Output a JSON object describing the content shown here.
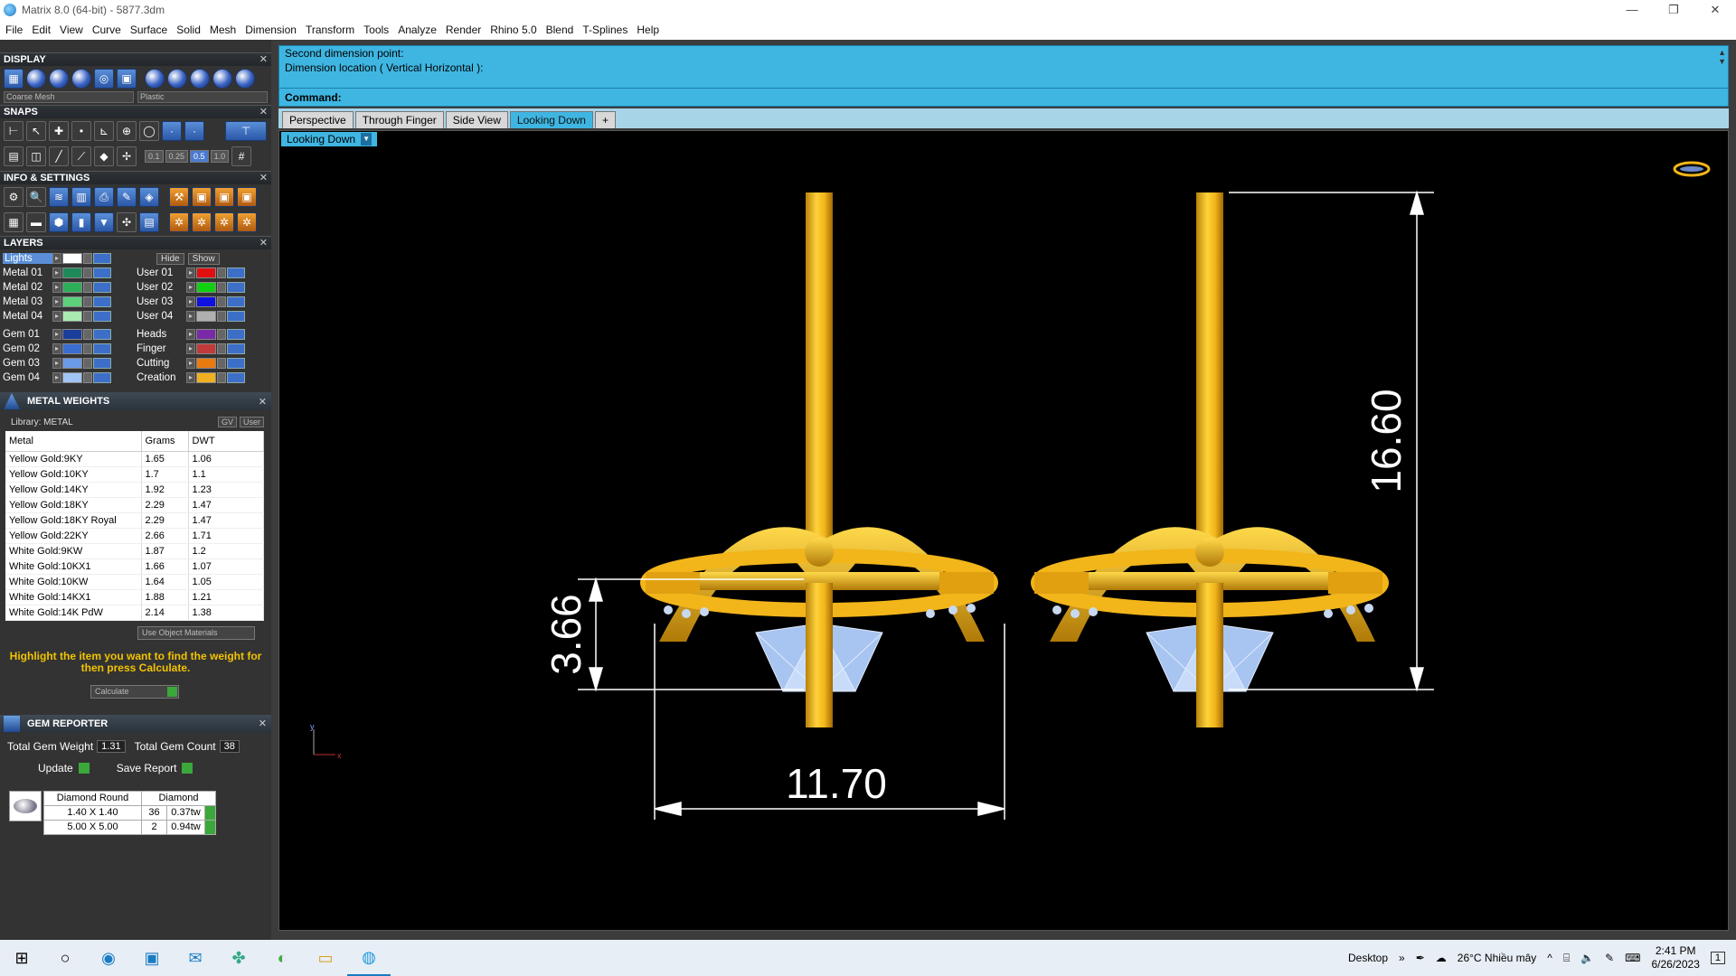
{
  "app": {
    "title": "Matrix 8.0 (64-bit) - 5877.3dm",
    "window_buttons": [
      "—",
      "❐",
      "✕"
    ]
  },
  "menu": [
    "File",
    "Edit",
    "View",
    "Curve",
    "Surface",
    "Solid",
    "Mesh",
    "Dimension",
    "Transform",
    "Tools",
    "Analyze",
    "Render",
    "Rhino 5.0",
    "Blend",
    "T-Splines",
    "Help"
  ],
  "panels": {
    "display": {
      "title": "DISPLAY",
      "mode": "Coarse Mesh",
      "material": "Plastic"
    },
    "snaps": {
      "title": "SNAPS",
      "values": [
        "0.1",
        "0.25",
        "0.5",
        "1.0"
      ]
    },
    "info": {
      "title": "INFO & SETTINGS"
    },
    "layers": {
      "title": "LAYERS",
      "hide": "Hide",
      "show": "Show",
      "lights": "Lights",
      "rows": [
        [
          {
            "name": "Metal 01",
            "color": "#1e8a5a"
          },
          {
            "name": "User 01",
            "color": "#e01010"
          }
        ],
        [
          {
            "name": "Metal 02",
            "color": "#2fae5a"
          },
          {
            "name": "User 02",
            "color": "#10d010"
          }
        ],
        [
          {
            "name": "Metal 03",
            "color": "#5cd07a"
          },
          {
            "name": "User 03",
            "color": "#1010e0"
          }
        ],
        [
          {
            "name": "Metal 04",
            "color": "#a8eab0"
          },
          {
            "name": "User 04",
            "color": "#b0b0b0"
          }
        ],
        [
          {
            "name": "Gem 01",
            "color": "#1a3e9a"
          },
          {
            "name": "Heads",
            "color": "#7a2aa8"
          }
        ],
        [
          {
            "name": "Gem 02",
            "color": "#3a6ed0"
          },
          {
            "name": "Finger",
            "color": "#c03a3a"
          }
        ],
        [
          {
            "name": "Gem 03",
            "color": "#6a9ae8"
          },
          {
            "name": "Cutting",
            "color": "#e87a10"
          }
        ],
        [
          {
            "name": "Gem 04",
            "color": "#a0c4f4"
          },
          {
            "name": "Creation",
            "color": "#f0b020"
          }
        ]
      ]
    },
    "metal_weights": {
      "title": "METAL WEIGHTS",
      "library": "Library: METAL",
      "gv": "GV",
      "user": "User",
      "headers": [
        "Metal",
        "Grams",
        "DWT"
      ],
      "rows": [
        [
          "Yellow Gold:9KY",
          "1.65",
          "1.06"
        ],
        [
          "Yellow Gold:10KY",
          "1.7",
          "1.1"
        ],
        [
          "Yellow Gold:14KY",
          "1.92",
          "1.23"
        ],
        [
          "Yellow Gold:18KY",
          "2.29",
          "1.47"
        ],
        [
          "Yellow Gold:18KY Royal",
          "2.29",
          "1.47"
        ],
        [
          "Yellow Gold:22KY",
          "2.66",
          "1.71"
        ],
        [
          "White Gold:9KW",
          "1.87",
          "1.2"
        ],
        [
          "White Gold:10KX1",
          "1.66",
          "1.07"
        ],
        [
          "White Gold:10KW",
          "1.64",
          "1.05"
        ],
        [
          "White Gold:14KX1",
          "1.88",
          "1.21"
        ],
        [
          "White Gold:14K PdW",
          "2.14",
          "1.38"
        ]
      ],
      "use_object": "Use Object Materials",
      "hint": "Highlight the item you want to find the weight for then press Calculate.",
      "calculate": "Calculate"
    },
    "gem_reporter": {
      "title": "GEM REPORTER",
      "total_weight_label": "Total Gem Weight",
      "total_weight": "1.31",
      "total_count_label": "Total Gem Count",
      "total_count": "38",
      "update": "Update",
      "save": "Save Report",
      "headers": [
        "Diamond Round",
        "Diamond"
      ],
      "rows": [
        [
          "1.40 X 1.40",
          "36",
          "0.37tw"
        ],
        [
          "5.00 X 5.00",
          "2",
          "0.94tw"
        ]
      ]
    }
  },
  "command": {
    "line1": "Second dimension point:",
    "line2": "Dimension location ( Vertical  Horizontal ):",
    "prompt": "Command:"
  },
  "tabs": [
    "Perspective",
    "Through Finger",
    "Side View",
    "Looking Down",
    "+"
  ],
  "active_tab": "Looking Down",
  "viewport": {
    "label": "Looking Down",
    "dimensions": {
      "width": "11.70",
      "height": "16.60",
      "depth": "3.66"
    },
    "axes": {
      "y": "y",
      "x": "x"
    }
  },
  "colors": {
    "accent": "#3fb6e2",
    "gold": "#f2b51a",
    "gem": "#a8c4f0",
    "dimension": "#ffffff"
  },
  "taskbar": {
    "desktop": "Desktop",
    "weather": "26°C  Nhiều mây",
    "time": "2:41 PM",
    "date": "6/26/2023",
    "notif": "1"
  }
}
